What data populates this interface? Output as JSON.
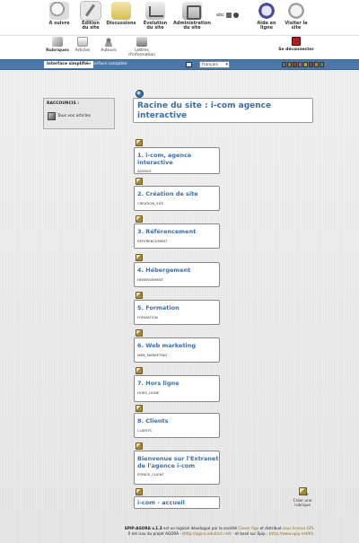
{
  "topnav": {
    "items": [
      {
        "label": "À suivre",
        "icon": "tasks-icon"
      },
      {
        "label": "Édition\ndu site",
        "icon": "edit-icon"
      },
      {
        "label": "Discussions",
        "icon": "forum-icon"
      },
      {
        "label": "Évolution\ndu site",
        "icon": "stats-icon"
      },
      {
        "label": "Administration\ndu site",
        "icon": "admin-icon"
      },
      {
        "label": "Aide en\nligne",
        "icon": "help-icon"
      },
      {
        "label": "Visiter le\nsite",
        "icon": "visit-icon"
      }
    ],
    "tools_label": "abc"
  },
  "subnav": {
    "items": [
      {
        "label": "Rubriques"
      },
      {
        "label": "Articles"
      },
      {
        "label": "Auteurs"
      },
      {
        "label": "Lettres\nd'information"
      }
    ],
    "logout": "Se déconnecter"
  },
  "bluebar": {
    "simple": "Interface simplifiée",
    "full": "Interface complète",
    "language": "français",
    "palette": [
      "#4a78a8",
      "#6a9f3e",
      "#b03a2e",
      "#8a6fb0",
      "#c9a12a",
      "#5a5a5a",
      "#d07a2a",
      "#2e8e8e"
    ]
  },
  "shortcuts": {
    "title": "RACCOURCIS :",
    "link": "Tous vos articles"
  },
  "root": {
    "title": "Racine du site : i-com agence interactive"
  },
  "rubriques": [
    {
      "title": "1. i-com, agence interactive",
      "code": "AGENCE"
    },
    {
      "title": "2. Création de site",
      "code": "CREATION_SITE"
    },
    {
      "title": "3. Référencement",
      "code": "REFERENCEMENT"
    },
    {
      "title": "4. Hébergement",
      "code": "HEBERGEMENT"
    },
    {
      "title": "5. Formation",
      "code": "FORMATION"
    },
    {
      "title": "6. Web marketing",
      "code": "WEB_MARKETING"
    },
    {
      "title": "7. Hors ligne",
      "code": "HORS_LIGNE"
    },
    {
      "title": "8. Clients",
      "code": "CLIENTS"
    },
    {
      "title": "Bienvenue sur l'Extranet de l'agence i-com",
      "code": "ESPACE_CLIENT"
    },
    {
      "title": "i-com - accueil",
      "code": ""
    }
  ],
  "create_rubrique": "Créer une\nrubrique",
  "footer": {
    "line1_a": "SPIP-AGORA v.1.3",
    "line1_b": " est un logiciel développé par la société ",
    "line1_c": "Clever Age",
    "line1_d": " et distribué ",
    "line1_e": "sous licence GPL",
    "line2_a": "Il est issu du projet AGORA - (",
    "line2_b": "http://agora.adullact.net",
    "line2_c": ") - et basé sur Spip - (",
    "line2_d": "http://www.spip.net/fr",
    "line2_e": ")."
  }
}
